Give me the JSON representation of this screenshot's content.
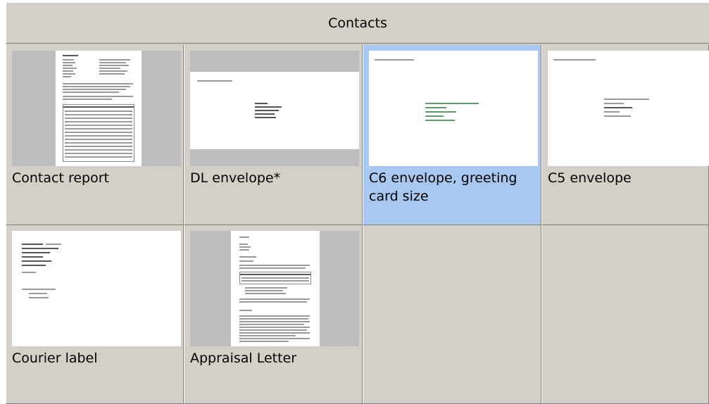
{
  "header": {
    "title": "Contacts"
  },
  "templates": [
    {
      "label": "Contact report"
    },
    {
      "label": "DL envelope*"
    },
    {
      "label": "C6 envelope, greeting card size",
      "selected": true
    },
    {
      "label": "C5 envelope"
    },
    {
      "label": "Courier label"
    },
    {
      "label": "Appraisal Letter"
    }
  ],
  "colors": {
    "panel": "#d4d0c8",
    "selected": "#a8c8f0",
    "thumb_bg": "#bdbdbd"
  }
}
